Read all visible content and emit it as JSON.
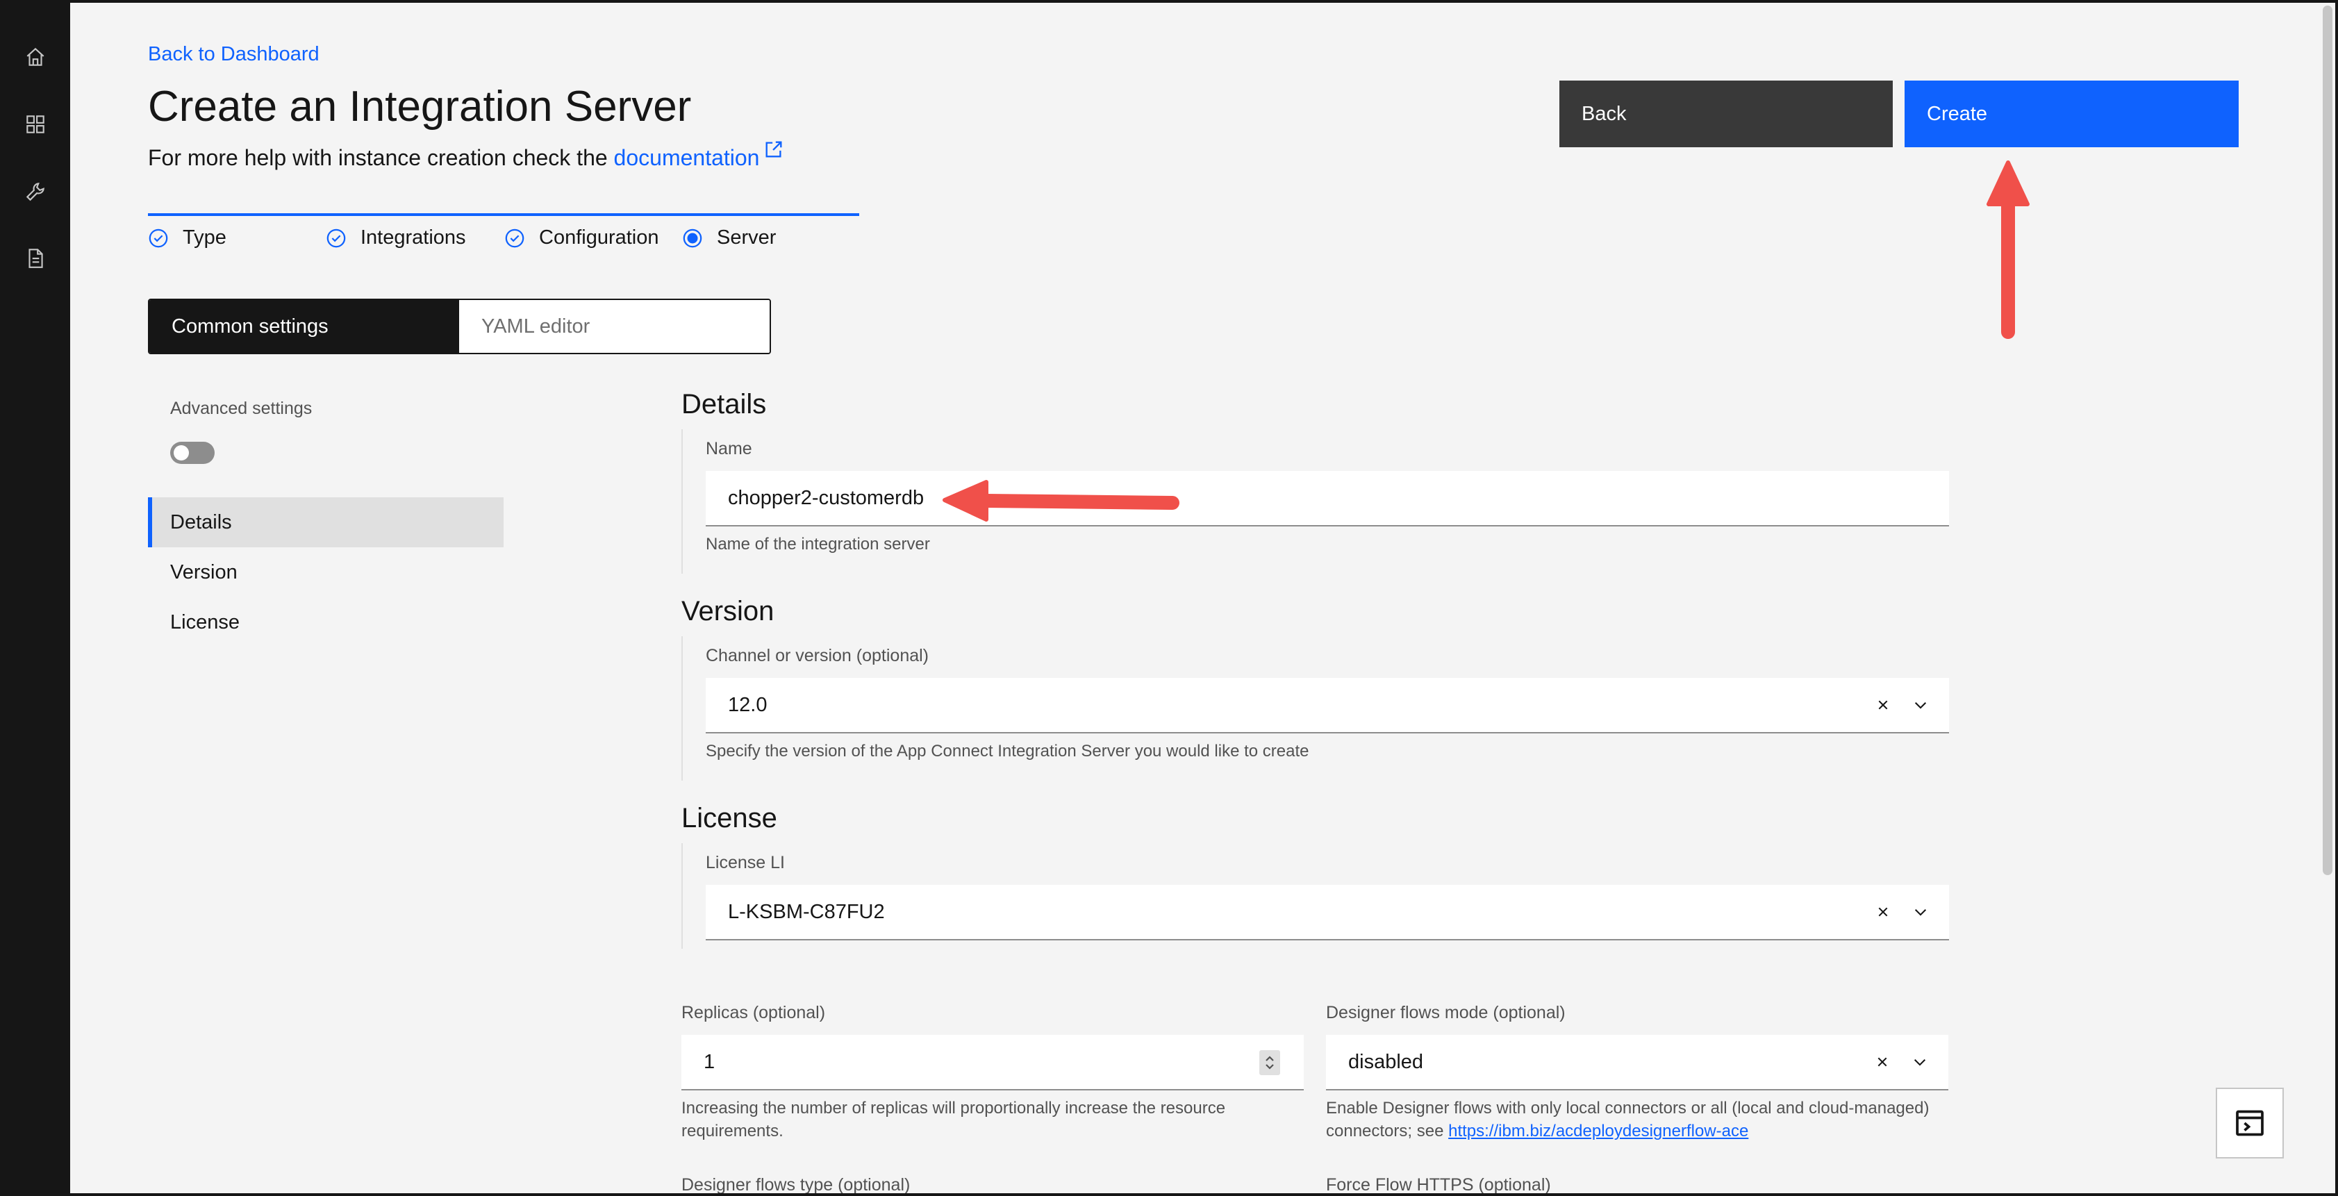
{
  "nav": {
    "back_link": "Back to Dashboard"
  },
  "header": {
    "title": "Create an Integration Server",
    "help_prefix": "For more help with instance creation check the ",
    "help_link": "documentation"
  },
  "steps": [
    {
      "label": "Type",
      "status": "complete"
    },
    {
      "label": "Integrations",
      "status": "complete"
    },
    {
      "label": "Configuration",
      "status": "complete"
    },
    {
      "label": "Server",
      "status": "current"
    }
  ],
  "tabs": {
    "common": "Common settings",
    "yaml": "YAML editor"
  },
  "sidebar": {
    "advanced_label": "Advanced settings",
    "advanced_enabled": false,
    "items": [
      {
        "label": "Details",
        "active": true
      },
      {
        "label": "Version",
        "active": false
      },
      {
        "label": "License",
        "active": false
      }
    ]
  },
  "actions": {
    "back": "Back",
    "create": "Create"
  },
  "details": {
    "heading": "Details",
    "name_label": "Name",
    "name_value": "chopper2-customerdb",
    "name_helper": "Name of the integration server"
  },
  "version": {
    "heading": "Version",
    "label": "Channel or version (optional)",
    "value": "12.0",
    "helper": "Specify the version of the App Connect Integration Server you would like to create"
  },
  "license": {
    "heading": "License",
    "label": "License LI",
    "value": "L-KSBM-C87FU2"
  },
  "replicas": {
    "label": "Replicas (optional)",
    "value": "1",
    "helper": "Increasing the number of replicas will proportionally increase the resource requirements."
  },
  "designer_mode": {
    "label": "Designer flows mode (optional)",
    "value": "disabled",
    "helper_prefix": "Enable Designer flows with only local connectors or all (local and cloud-managed) connectors; see ",
    "helper_link": "https://ibm.biz/acdeploydesignerflow-ace"
  },
  "designer_type": {
    "label": "Designer flows type (optional)"
  },
  "force_https": {
    "label": "Force Flow HTTPS (optional)"
  },
  "colors": {
    "accent": "#0f62fe",
    "annotation_arrow": "#f0504a"
  }
}
